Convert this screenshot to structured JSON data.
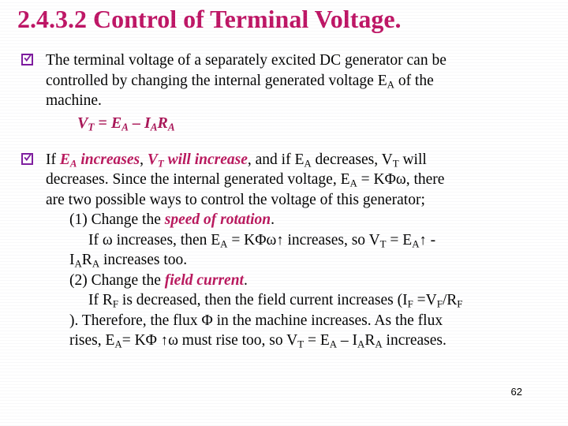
{
  "slide": {
    "title": "2.4.3.2 Control of Terminal Voltage.",
    "title_color": "#BE1464",
    "accent_color": "#B9165C",
    "bullet_color": "#7D1A9E",
    "page_number": "62"
  },
  "bullets": [
    {
      "icon": "checkbox-checked",
      "lines": [
        "The terminal voltage of a separately excited DC generator can be",
        "controlled by changing the internal generated voltage E",
        "A",
        " of the",
        "machine."
      ],
      "text_plain": "The terminal voltage of a separately excited DC generator can be controlled by changing the internal generated voltage EA of the machine.",
      "equation": {
        "lhs": "V",
        "lhs_sub": "T",
        "eq": "=",
        "t1": "E",
        "t1_sub": "A",
        "minus": "–",
        "t2": "I",
        "t2_sub": "A",
        "t3": "R",
        "t3_sub": "A",
        "plain": "VT = EA – IARA"
      }
    },
    {
      "icon": "checkbox-checked",
      "text_plain": "If EA increases, VT will increase, and if EA decreases, VT will decreases. Since the internal generated voltage, EA = KΦω, there are two possible ways to control the voltage of this generator;"
    }
  ],
  "paragraph2": {
    "seg_if": "If ",
    "seg_ea_hl": "E",
    "seg_ea_hl_sub": "A",
    "seg_increases_hl": " increases",
    "seg_comma": ", ",
    "seg_vt_hl": "V",
    "seg_vt_hl_sub": "T",
    "seg_willincrease_hl": " will increase",
    "seg_and_if": ", and if E",
    "seg_and_if_sub": "A",
    "seg_decreases": " decreases, V",
    "seg_vt2_sub": "T",
    "seg_will": " will",
    "line2_a": "decreases. Since the internal generated voltage, E",
    "line2_sub": "A",
    "line2_b": " = KΦω, there",
    "line3": "are two possible ways to control the voltage of this generator;"
  },
  "items": [
    {
      "label_pre": "(1) Change the ",
      "label_hl": "speed of rotation",
      "label_post": ".",
      "detail_lines": [
        {
          "a": "If ω increases, then E",
          "a_sub": "A",
          "b": " = KΦω",
          "arrow": "↑",
          "c": " increases, so V",
          "c_sub": "T",
          "d": " = E",
          "d_sub": "A",
          "arrow2": "↑",
          "e": " -"
        },
        {
          "a": "I",
          "a_sub": "A",
          "b": "R",
          "b_sub": "A",
          "c": " increases too."
        }
      ]
    },
    {
      "label_pre": "(2) Change the ",
      "label_hl": "field current",
      "label_post": ".",
      "detail_lines": [
        {
          "a": "If R",
          "a_sub": "F",
          "b": " is decreased, then the field current increases (I",
          "b_sub": "F",
          "c": " =V",
          "c_sub": "F",
          "d": "/R",
          "d_sub": "F"
        },
        {
          "a": "). Therefore, the flux Φ in the machine increases. As the flux"
        },
        {
          "a": "rises, E",
          "a_sub": "A",
          "b": "= KΦ ",
          "arrow": "↑",
          "c": "ω must rise too, so V",
          "c_sub": "T",
          "d": " = E",
          "d_sub": "A",
          "e": " – I",
          "e_sub": "A",
          "f": "R",
          "f_sub": "A",
          "g": "  increases."
        }
      ]
    }
  ]
}
